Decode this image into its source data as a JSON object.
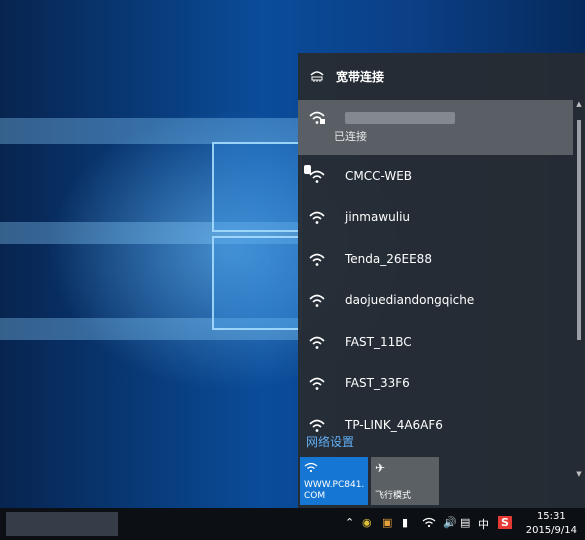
{
  "flyout": {
    "header": "宽带连接",
    "networks": [
      {
        "name": "",
        "status": "已连接",
        "selected": true,
        "secured": true
      },
      {
        "name": "CMCC-WEB",
        "warning": true
      },
      {
        "name": "jinmawuliu"
      },
      {
        "name": "Tenda_26EE88"
      },
      {
        "name": "daojuediandongqiche"
      },
      {
        "name": "FAST_11BC"
      },
      {
        "name": "FAST_33F6"
      },
      {
        "name": "TP-LINK_4A6AF6"
      }
    ],
    "settings_link": "网络设置",
    "tiles": {
      "wifi_label": "WWW.PC841.\nCOM",
      "airplane_label": "飞行模式"
    }
  },
  "taskbar": {
    "ime": "中",
    "time": "15:31",
    "date": "2015/9/14"
  },
  "colors": {
    "accent": "#1577d3",
    "link": "#63aef5",
    "panel": "#262c32"
  }
}
